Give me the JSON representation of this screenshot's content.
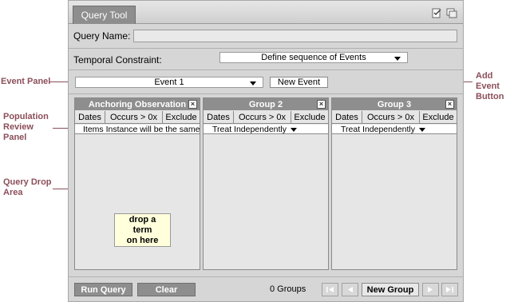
{
  "annotations": {
    "event_panel": "Event Panel",
    "population_review_panel": [
      "Population",
      "Review",
      "Panel"
    ],
    "query_drop_area": [
      "Query Drop",
      "Area"
    ],
    "add_event_button": [
      "Add Event",
      "Button"
    ]
  },
  "window": {
    "tab_label": "Query Tool",
    "icons": [
      "edit-icon",
      "copy-icon"
    ]
  },
  "query_name": {
    "label": "Query Name:",
    "value": ""
  },
  "temporal": {
    "label": "Temporal Constraint:",
    "selected": "Define sequence of Events"
  },
  "event": {
    "selected": "Event 1",
    "new_event_label": "New Event"
  },
  "groups": [
    {
      "title": "Anchoring Observation",
      "buttons": [
        "Dates",
        "Occurs > 0x",
        "Exclude"
      ],
      "selector": "Items Instance will be the same",
      "drop_hint": [
        "drop a",
        "term",
        "on here"
      ]
    },
    {
      "title": "Group 2",
      "buttons": [
        "Dates",
        "Occurs > 0x",
        "Exclude"
      ],
      "selector": "Treat Independently"
    },
    {
      "title": "Group 3",
      "buttons": [
        "Dates",
        "Occurs > 0x",
        "Exclude"
      ],
      "selector": "Treat Independently"
    }
  ],
  "footer": {
    "run_query": "Run Query",
    "clear": "Clear",
    "group_count": "0 Groups",
    "new_group": "New Group",
    "pager_icons": [
      "first-page-icon",
      "prev-page-icon",
      "next-page-icon",
      "last-page-icon"
    ]
  }
}
